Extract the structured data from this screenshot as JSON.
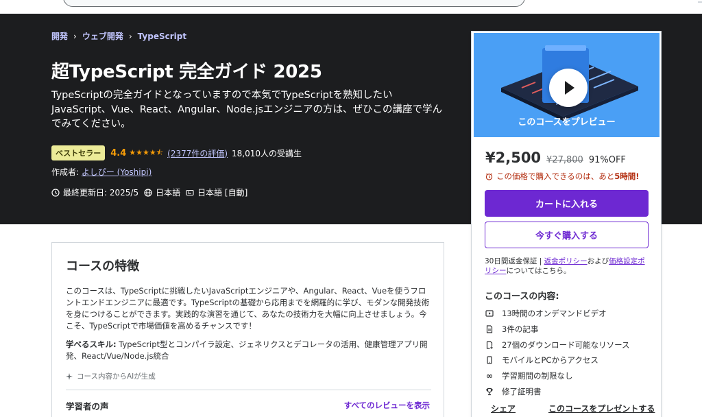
{
  "breadcrumb": [
    "開発",
    "ウェブ開発",
    "TypeScript"
  ],
  "course": {
    "title": "超TypeScript 完全ガイド 2025",
    "subtitle": "TypeScriptの完全ガイドとなっていますので本気でTypeScriptを熟知したいJavaScript、Vue、React、Angular、Node.jsエンジニアの方は、ぜひこの講座で学んでみてください。",
    "badge": "ベストセラー",
    "rating": "4.4",
    "stars": 4.4,
    "rating_count": "(2377件の評価)",
    "students": "18,010人の受講生",
    "instructor_prefix": "作成者: ",
    "instructor": "よしぴー (Yoshipi)",
    "last_updated": "最終更新日: 2025/5",
    "language": "日本語",
    "captions": "日本語 [自動]"
  },
  "sidebar": {
    "preview_label": "このコースをプレビュー",
    "price_current": "¥2,500",
    "price_original": "¥27,800",
    "price_discount": "91%OFF",
    "timer_prefix": "この価格で購入できるのは、あと",
    "timer_hours": "5時間!",
    "add_to_cart": "カートに入れる",
    "buy_now": "今すぐ購入する",
    "guarantee_prefix": "30日間返金保証 | ",
    "refund_policy": "返金ポリシー",
    "and": "および",
    "pricing_policy": "価格設定ポリシー",
    "guarantee_suffix": "についてはこちら。",
    "includes_title": "このコースの内容:",
    "includes": [
      {
        "icon": "video-icon",
        "text": "13時間のオンデマンドビデオ"
      },
      {
        "icon": "article-icon",
        "text": "3件の記事"
      },
      {
        "icon": "download-icon",
        "text": "27個のダウンロード可能なリソース"
      },
      {
        "icon": "mobile-icon",
        "text": "モバイルとPCからアクセス"
      },
      {
        "icon": "infinity-icon",
        "text": "学習期間の制限なし"
      },
      {
        "icon": "trophy-icon",
        "text": "修了証明書"
      }
    ],
    "share": "シェア",
    "gift": "このコースをプレゼントする"
  },
  "features": {
    "title": "コースの特徴",
    "description": "このコースは、TypeScriptに挑戦したいJavaScriptエンジニアや、Angular、React、Vueを使うフロントエンドエンジニアに最適です。TypeScriptの基礎から応用までを網羅的に学び、モダンな開発技術を身につけることができます。実践的な演習を通じて、あなたの技術力を大幅に向上させましょう。今こそ、TypeScriptで市場価値を高めるチャンスです！",
    "skills_label": "学べるスキル:",
    "skills": " TypeScript型とコンパイラ設定、ジェネリクスとデコレータの活用、健康管理アプリ開発、React/Vue/Node.js統合",
    "ai_note": "コース内容からAIが生成",
    "reviews_title": "学習者の声",
    "reviews_link": "すべてのレビューを表示"
  },
  "colors": {
    "hero_bg": "#1c1d1f",
    "accent": "#6d28d2",
    "star": "#f69c08",
    "badge": "#eceb98",
    "preview_bg": "#4a9ff5",
    "timer": "#b32d0f"
  }
}
